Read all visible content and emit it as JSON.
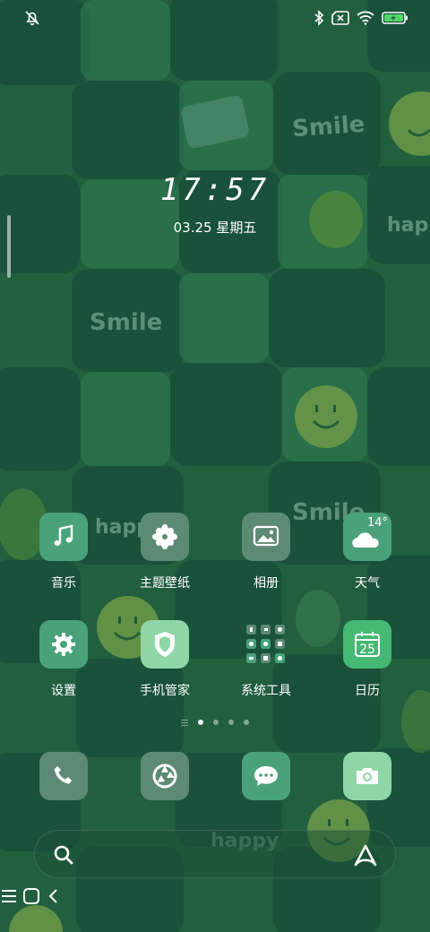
{
  "colors": {
    "wallpaper_dark": "#1c5a3a",
    "wallpaper_light": "#2a7a50",
    "tile_green": "#4aa27a",
    "tile_gray": "#5c8a72",
    "tile_mint": "#8fd6a6",
    "tile_bright": "#45b873"
  },
  "status_bar": {
    "left_icon": "bell-off-icon",
    "right_icons": [
      "bluetooth-icon",
      "no-sim-icon",
      "wifi-icon",
      "battery-charging-icon"
    ]
  },
  "clock": {
    "time": "17:57",
    "date": "03.25 星期五"
  },
  "apps": [
    {
      "label": "音乐",
      "icon": "music-note-icon"
    },
    {
      "label": "主题壁纸",
      "icon": "theme-flower-icon"
    },
    {
      "label": "相册",
      "icon": "gallery-icon"
    },
    {
      "label": "天气",
      "icon": "weather-icon",
      "badge": "14°"
    },
    {
      "label": "设置",
      "icon": "gear-icon"
    },
    {
      "label": "手机管家",
      "icon": "shield-icon"
    },
    {
      "label": "系统工具",
      "icon": "folder-grid-icon"
    },
    {
      "label": "日历",
      "icon": "calendar-icon",
      "badge": "25"
    }
  ],
  "page_indicator": {
    "pages": 4,
    "active": 1
  },
  "dock": [
    {
      "icon": "phone-icon"
    },
    {
      "icon": "browser-icon"
    },
    {
      "icon": "messages-icon"
    },
    {
      "icon": "camera-icon"
    }
  ],
  "search": {
    "left_icon": "search-icon",
    "right_icon": "assistant-icon"
  },
  "nav": {
    "icons": [
      "menu-icon",
      "home-icon",
      "back-icon"
    ]
  }
}
